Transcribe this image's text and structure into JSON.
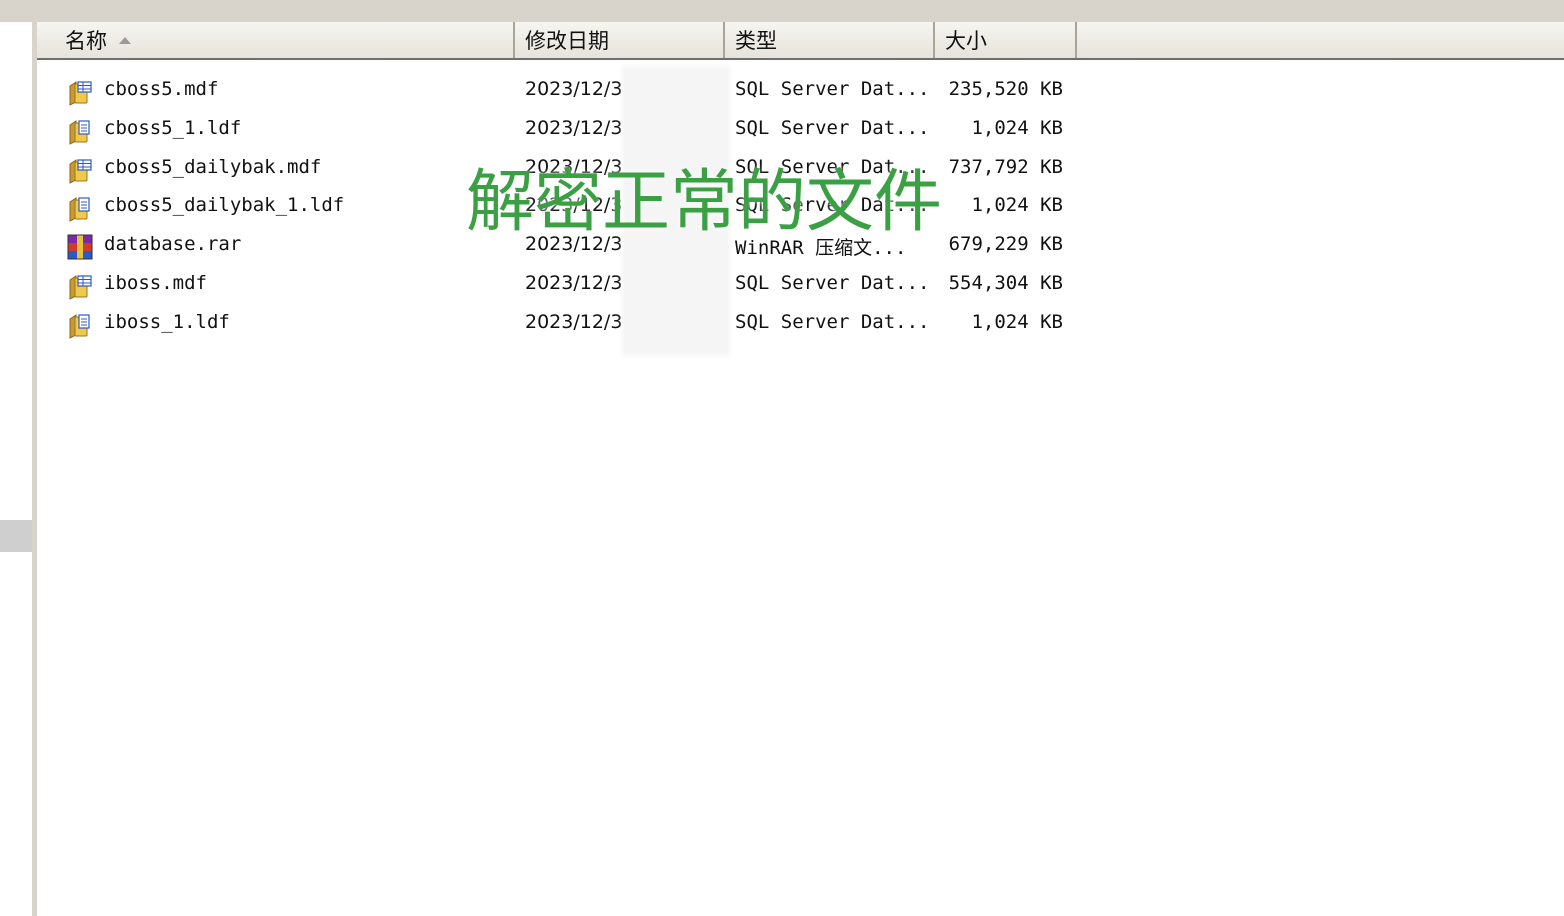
{
  "columns": {
    "name": "名称",
    "date": "修改日期",
    "type": "类型",
    "size": "大小"
  },
  "files": [
    {
      "name": "cboss5.mdf",
      "date": "2023/12/3",
      "type": "SQL Server Dat...",
      "size": "235,520 KB",
      "icon": "sql-data-file-icon"
    },
    {
      "name": "cboss5_1.ldf",
      "date": "2023/12/3",
      "type": "SQL Server Dat...",
      "size": "1,024 KB",
      "icon": "sql-log-file-icon"
    },
    {
      "name": "cboss5_dailybak.mdf",
      "date": "2023/12/3",
      "type": "SQL Server Dat...",
      "size": "737,792 KB",
      "icon": "sql-data-file-icon"
    },
    {
      "name": "cboss5_dailybak_1.ldf",
      "date": "2023/12/3",
      "type": "SQL Server Dat...",
      "size": "1,024 KB",
      "icon": "sql-log-file-icon"
    },
    {
      "name": "database.rar",
      "date": "2023/12/3",
      "type": "WinRAR 压缩文...",
      "size": "679,229 KB",
      "icon": "winrar-archive-icon"
    },
    {
      "name": "iboss.mdf",
      "date": "2023/12/3",
      "type": "SQL Server Dat...",
      "size": "554,304 KB",
      "icon": "sql-data-file-icon"
    },
    {
      "name": "iboss_1.ldf",
      "date": "2023/12/3",
      "type": "SQL Server Dat...",
      "size": "1,024 KB",
      "icon": "sql-log-file-icon"
    }
  ],
  "overlay_caption": "解密正常的文件",
  "colors": {
    "caption": "#3aa043",
    "header_bg": "#ece9e1"
  }
}
